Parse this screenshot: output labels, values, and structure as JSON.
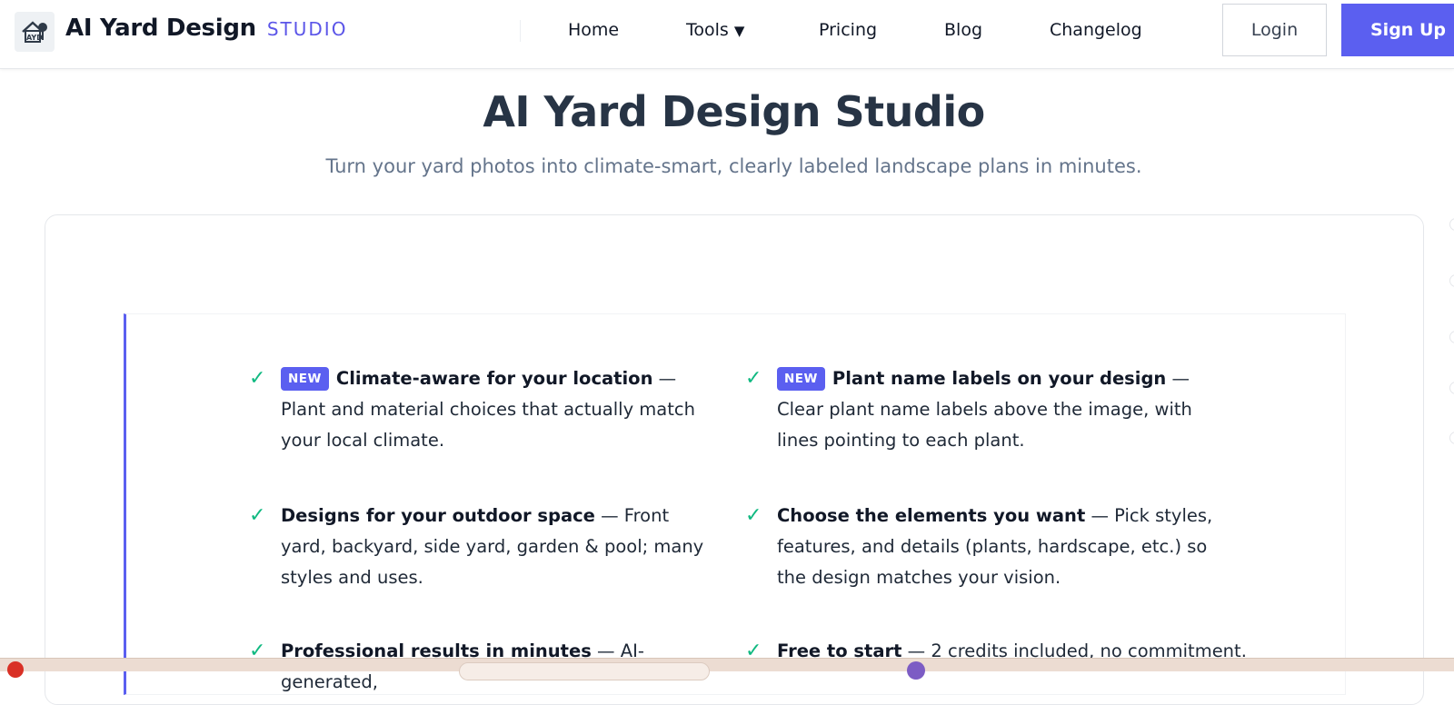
{
  "brand": {
    "name": "AI Yard Design",
    "sub": "STUDIO",
    "logo_icon": "house-tree-logo-icon"
  },
  "nav": {
    "items": [
      {
        "label": "Home"
      },
      {
        "label": "Tools",
        "caret": "▼"
      },
      {
        "label": "Pricing"
      },
      {
        "label": "Blog"
      },
      {
        "label": "Changelog"
      }
    ],
    "login": "Login",
    "signup": "Sign Up"
  },
  "hero": {
    "title": "AI Yard Design Studio",
    "subtitle": "Turn your yard photos into climate-smart, clearly labeled landscape plans in minutes."
  },
  "features": [
    {
      "badge": "NEW",
      "title": "Climate-aware for your location",
      "desc": " — Plant and material choices that actually match your local climate."
    },
    {
      "badge": "NEW",
      "title": "Plant name labels on your design",
      "desc": " — Clear plant name labels above the image, with lines pointing to each plant."
    },
    {
      "badge": "",
      "title": "Designs for your outdoor space",
      "desc": " — Front yard, backyard, side yard, garden & pool; many styles and uses."
    },
    {
      "badge": "",
      "title": "Choose the elements you want",
      "desc": " — Pick styles, features, and details (plants, hardscape, etc.) so the design matches your vision."
    },
    {
      "badge": "",
      "title": "Professional results in minutes",
      "desc": " — AI-generated,"
    },
    {
      "badge": "",
      "title": "Free to start",
      "desc": " — 2 credits included, no commitment."
    }
  ],
  "check_glyph": "✓",
  "colors": {
    "accent": "#5b5ff0",
    "check": "#10b981",
    "title": "#273445",
    "subtitle": "#64748b"
  }
}
